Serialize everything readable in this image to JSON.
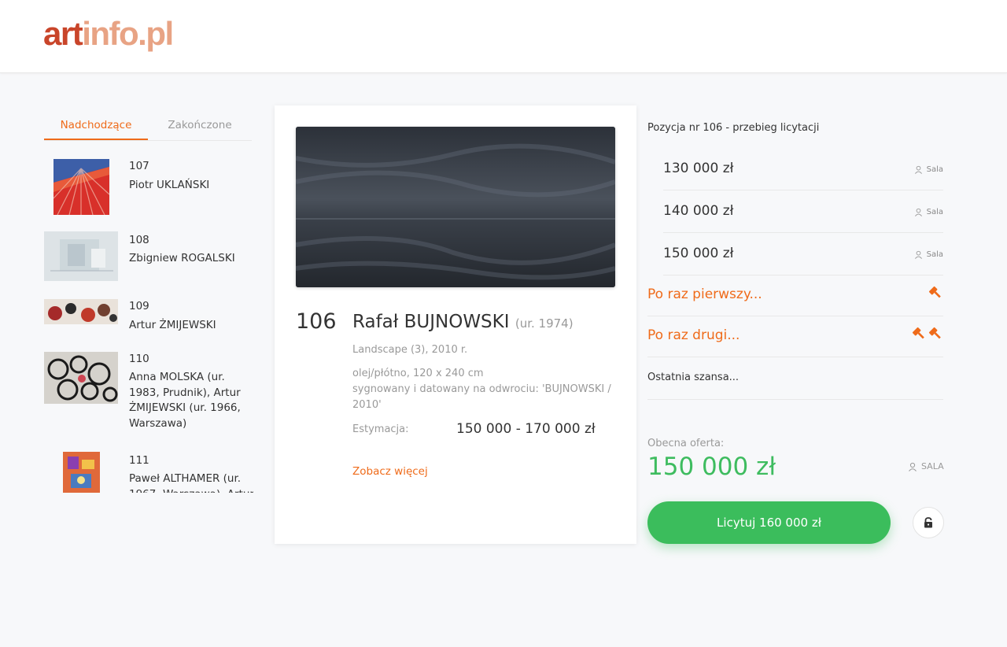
{
  "header": {
    "logo_part1": "art",
    "logo_part2": "info.pl"
  },
  "sidebar": {
    "tabs": [
      {
        "label": "Nadchodzące",
        "active": true
      },
      {
        "label": "Zakończone",
        "active": false
      }
    ],
    "lots": [
      {
        "number": "107",
        "artist": "Piotr UKLAŃSKI"
      },
      {
        "number": "108",
        "artist": "Zbigniew ROGALSKI"
      },
      {
        "number": "109",
        "artist": "Artur ŻMIJEWSKI"
      },
      {
        "number": "110",
        "artist": "Anna MOLSKA (ur. 1983, Prudnik), Artur ŻMIJEWSKI (ur. 1966, Warszawa)"
      },
      {
        "number": "111",
        "artist": "Paweł ALTHAMER (ur. 1967, Warszawa), Artur"
      }
    ]
  },
  "lot": {
    "number": "106",
    "artist": "Rafał BUJNOWSKI",
    "born": "(ur. 1974)",
    "title_year": "Landscape (3), 2010 r.",
    "technique": "olej/płótno, 120 x 240 cm",
    "signature": "sygnowany i datowany na odwrociu: 'BUJNOWSKI / 2010'",
    "estimate_label": "Estymacja:",
    "estimate_value": "150 000 - 170 000 zł",
    "more_link": "Zobacz więcej"
  },
  "bidding": {
    "title": "Pozycja nr 106 - przebieg licytacji",
    "bids": [
      {
        "amount": "130 000 zł",
        "source": "Sala"
      },
      {
        "amount": "140 000 zł",
        "source": "Sala"
      },
      {
        "amount": "150 000 zł",
        "source": "Sala"
      }
    ],
    "call_first": "Po raz pierwszy...",
    "call_second": "Po raz drugi...",
    "last_chance": "Ostatnia szansa...",
    "offer_label": "Obecna oferta:",
    "offer_amount": "150 000 zł",
    "offer_source": "SALA",
    "bid_button": "Licytuj 160 000 zł",
    "accent_color": "#ef6b1a",
    "success_color": "#3bbd5c"
  }
}
